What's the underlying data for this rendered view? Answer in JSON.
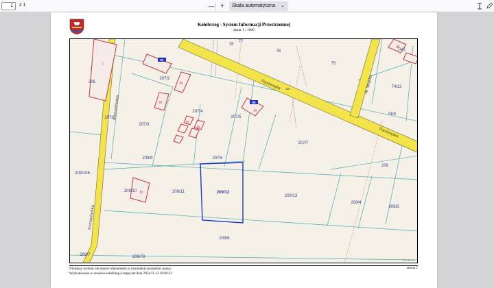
{
  "toolbar": {
    "page_number": "1",
    "page_count": "z 1",
    "zoom_out": "—",
    "zoom_in": "+",
    "scale_value": "Skala automatyczna"
  },
  "document": {
    "title": "Kołobrzeg - System Informacji Przestrzennej",
    "scale": "skala 1 : 1000",
    "footer_line1": "Niniejszy wydruk nie stanowi dokumentu w rozumieniu przepisów prawa.",
    "footer_line2": "Wydrukowano w serwisie kołobrzeg e-mapa.net dnia 2024-11-12 20:09:32",
    "page_label": "strona 1",
    "map_attribution": "© e-mapa.net",
    "colors": {
      "road_fill": "#f2e44a",
      "road_edge": "#6b6b3a",
      "building_outline": "#c4373c",
      "parcel_label": "#2c3f8f",
      "parcel_line": "#4aa6b5",
      "selected_parcel": "#1d36d2",
      "map_bg": "#f5f1e6"
    }
  },
  "map": {
    "streets": [
      "Piastowska",
      "Piastowska",
      "Komanówska",
      "Komanówska",
      "Al. Wojska"
    ],
    "parcels": [
      "209/12",
      "209/11",
      "209/13",
      "209/10",
      "209/108",
      "209/9",
      "207/6",
      "207/7",
      "207/5",
      "207/4",
      "207/3",
      "207/2",
      "207/1",
      "206",
      "209/6",
      "209/4",
      "209/5",
      "208",
      "74/9",
      "74/13",
      "74/2",
      "75",
      "76",
      "77",
      "78",
      "209/78",
      "209/7",
      "15+"
    ],
    "building_tags": [
      "m",
      "m",
      "m",
      "m",
      "m",
      "i",
      "m",
      "m"
    ],
    "house_numbers": [
      "91",
      "90"
    ],
    "selected_parcel": "209/12"
  }
}
